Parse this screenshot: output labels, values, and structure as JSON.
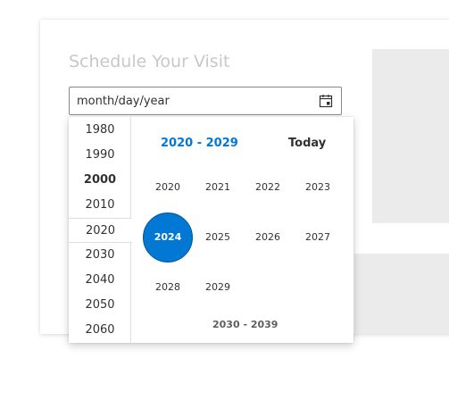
{
  "form": {
    "title": "Schedule Your Visit",
    "date_placeholder": "month/day/year",
    "calendar_icon": "calendar-icon"
  },
  "picker": {
    "decades": [
      "1980",
      "1990",
      "2000",
      "2010",
      "2020",
      "2030",
      "2040",
      "2050",
      "2060"
    ],
    "bold_decade": "2000",
    "selected_decade": "2020",
    "range_label": "2020 - 2029",
    "today_label": "Today",
    "years": [
      "2020",
      "2021",
      "2022",
      "2023",
      "2024",
      "2025",
      "2026",
      "2027",
      "2028",
      "2029"
    ],
    "selected_year": "2024",
    "next_range_label": "2030 - 2039"
  },
  "colors": {
    "accent": "#0078d4",
    "text": "#323130",
    "muted_title": "#c8c8c8",
    "panel_gray": "#ebebeb"
  }
}
